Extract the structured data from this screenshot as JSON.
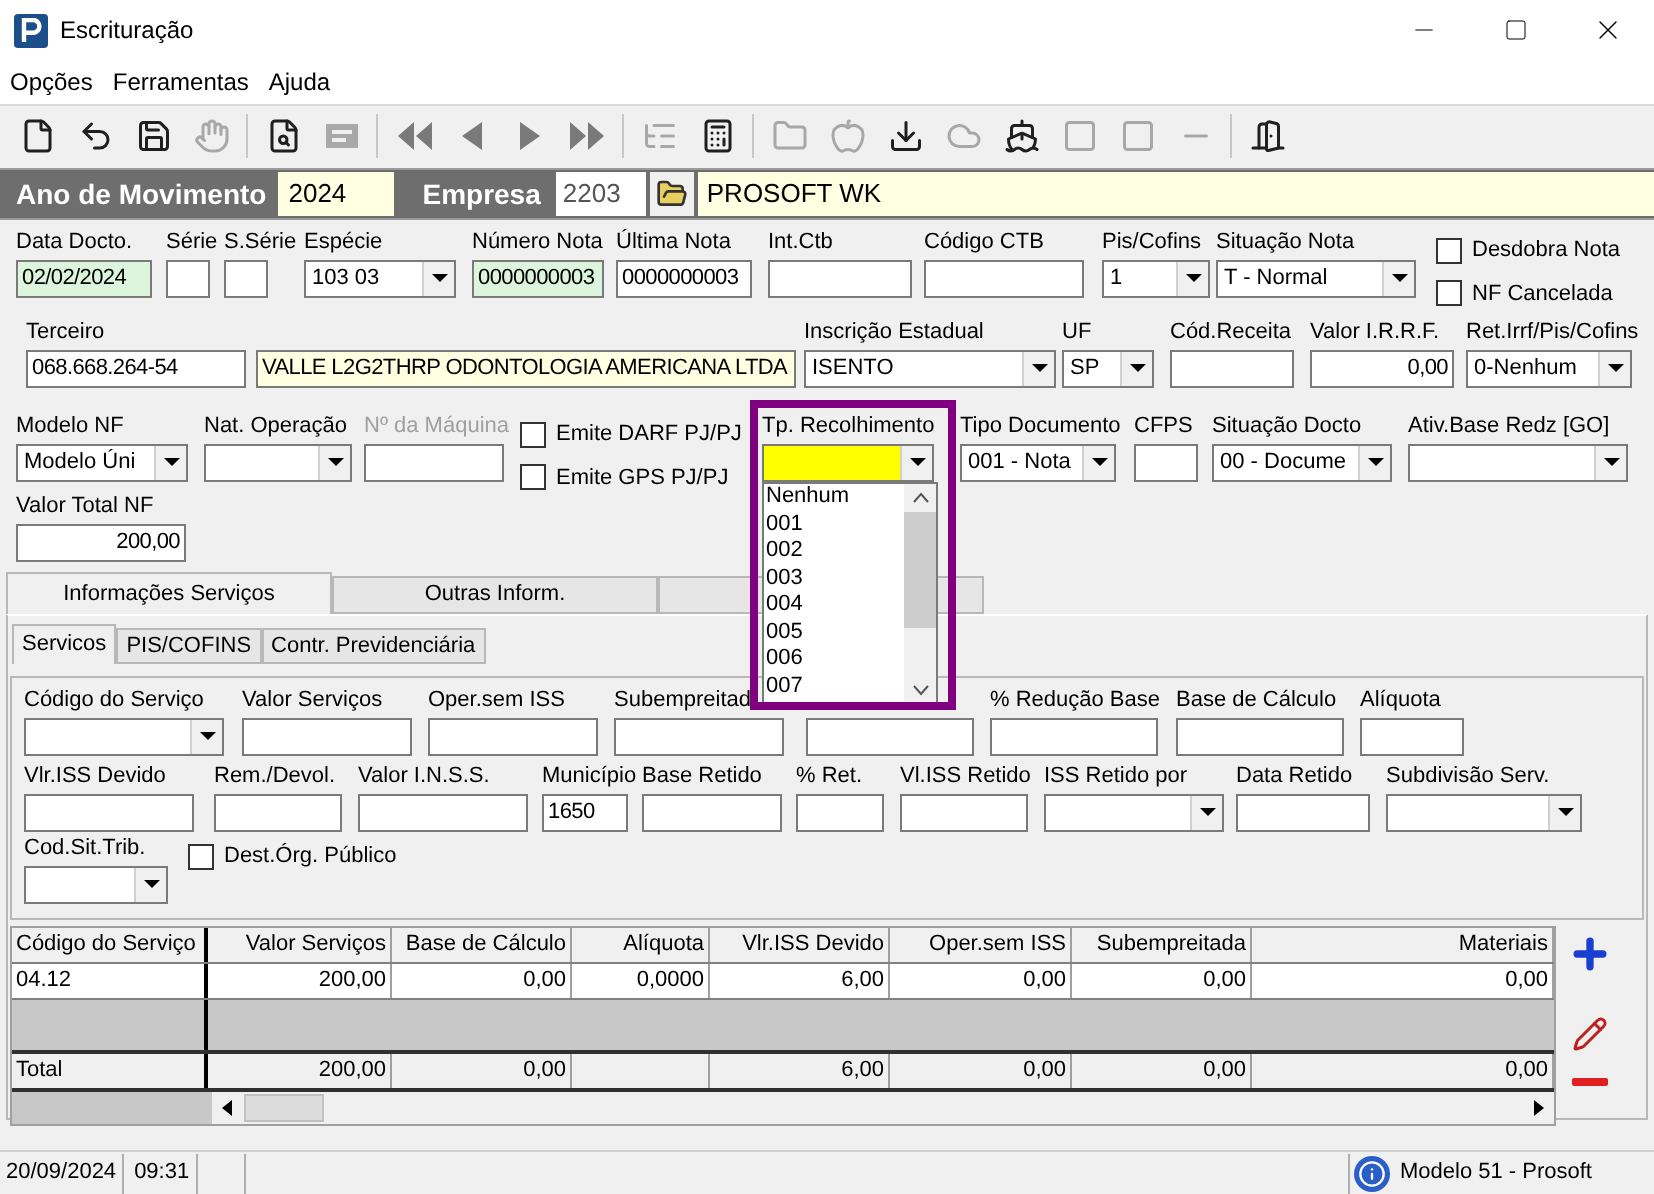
{
  "window": {
    "title": "Escrituração"
  },
  "menu": [
    "Opções",
    "Ferramentas",
    "Ajuda"
  ],
  "toolbar": [
    {
      "disabled": false
    },
    {
      "disabled": false
    },
    {
      "disabled": false
    },
    {
      "disabled": true
    },
    {
      "disabled": false
    },
    {
      "disabled": true
    },
    {
      "disabled": false
    },
    {
      "disabled": false
    },
    {
      "disabled": false
    },
    {
      "disabled": false
    },
    {
      "disabled": true
    },
    {
      "disabled": false
    },
    {
      "disabled": true
    },
    {
      "disabled": true
    },
    {
      "disabled": false
    },
    {
      "disabled": true
    },
    {
      "disabled": false
    },
    {
      "disabled": true
    },
    {
      "disabled": true
    },
    {
      "disabled": true
    },
    {
      "disabled": false
    }
  ],
  "header": {
    "year_label": "Ano de Movimento",
    "year": "2024",
    "company_label": "Empresa",
    "company_code": "2203",
    "company_name": "PROSOFT WK"
  },
  "form_rows": [
    {
      "fields": [
        {
          "label": "Data Docto.",
          "kind": "text",
          "value": "02/02/2024",
          "color": "#dcf5dc"
        },
        {
          "label": "Série",
          "kind": "text"
        },
        {
          "label": "S.Série",
          "kind": "text"
        },
        {
          "label": "Espécie",
          "kind": "combo",
          "value": "103 03"
        },
        {
          "label": "Número Nota",
          "kind": "text",
          "value": "0000000003",
          "color": "#dcf5dc"
        },
        {
          "label": "Última Nota",
          "kind": "text",
          "value": "0000000003"
        },
        {
          "label": "Int.Ctb",
          "kind": "text"
        },
        {
          "label": "Código CTB",
          "kind": "text"
        },
        {
          "label": "Pis/Cofins",
          "kind": "combo",
          "value": "1"
        },
        {
          "label": "Situação Nota",
          "kind": "combo",
          "value": "T - Normal"
        },
        {
          "kind": "checks",
          "items": [
            {
              "label": "Desdobra Nota",
              "checked": false
            },
            {
              "label": "NF Cancelada",
              "checked": false
            }
          ]
        }
      ]
    },
    {
      "fields": [
        {
          "label": "Terceiro",
          "kind": "text",
          "value": "068.668.264-54"
        },
        {
          "kind": "text",
          "value": "VALLE L2G2THRP ODONTOLOGIA AMERICANA LTDA",
          "color": "#ffffe1"
        },
        {
          "label": "Inscrição Estadual",
          "kind": "combo",
          "value": "ISENTO"
        },
        {
          "label": "UF",
          "kind": "combo",
          "value": "SP"
        },
        {
          "label": "Cód.Receita",
          "kind": "text"
        },
        {
          "label": "Valor I.R.R.F.",
          "kind": "number",
          "value": "0,00"
        },
        {
          "label": "Ret.Irrf/Pis/Cofins",
          "kind": "combo",
          "value": "0-Nenhum"
        }
      ]
    },
    {
      "fields": [
        {
          "label": "Modelo NF",
          "kind": "combo",
          "value": "Modelo Úni"
        },
        {
          "label": "Nat. Operação",
          "kind": "combo"
        },
        {
          "label": "Nº da Máquina",
          "kind": "text",
          "disabled": true
        },
        {
          "kind": "checks",
          "items": [
            {
              "label": "Emite DARF PJ/PJ",
              "checked": false
            },
            {
              "label": "Emite GPS PJ/PJ",
              "checked": false
            }
          ]
        },
        {
          "label": "Tp. Recolhimento",
          "kind": "combo",
          "color": "#ffff00",
          "expanded": true,
          "highlighted": true,
          "options": [
            "Nenhum",
            "001",
            "002",
            "003",
            "004",
            "005",
            "006",
            "007"
          ]
        },
        {
          "label": "Tipo Documento",
          "kind": "combo",
          "value": "001 - Nota"
        },
        {
          "label": "CFPS",
          "kind": "text"
        },
        {
          "label": "Situação Docto",
          "kind": "combo",
          "value": "00 - Docume"
        },
        {
          "label": "Ativ.Base Redz [GO]",
          "kind": "combo"
        }
      ]
    },
    {
      "fields": [
        {
          "label": "Valor Total NF",
          "kind": "number",
          "value": "200,00"
        }
      ]
    }
  ],
  "tabs": [
    {
      "label": "Informações Serviços",
      "selected": true
    },
    {
      "label": "Outras Inform.",
      "selected": false
    },
    {
      "selected": false
    }
  ],
  "subtabs": [
    {
      "label": "Servicos",
      "selected": true
    },
    {
      "label": "PIS/COFINS",
      "selected": false
    },
    {
      "label": "Contr. Previdenciária",
      "selected": false
    }
  ],
  "service_rows": [
    {
      "fields": [
        {
          "label": "Código do Serviço",
          "kind": "combo"
        },
        {
          "label": "Valor Serviços",
          "kind": "text"
        },
        {
          "label": "Oper.sem ISS",
          "kind": "text"
        },
        {
          "label": "Subempreitad",
          "kind": "text"
        },
        {
          "kind": "text"
        },
        {
          "label": "% Redução Base",
          "kind": "text"
        },
        {
          "label": "Base de Cálculo",
          "kind": "text"
        },
        {
          "label": "Alíquota",
          "kind": "text"
        }
      ]
    },
    {
      "fields": [
        {
          "label": "Vlr.ISS Devido",
          "kind": "text"
        },
        {
          "label": "Rem./Devol.",
          "kind": "text"
        },
        {
          "label": "Valor I.N.S.S.",
          "kind": "text"
        },
        {
          "label": "Município",
          "kind": "text",
          "value": "1650"
        },
        {
          "label": "Base Retido",
          "kind": "text"
        },
        {
          "label": "% Ret.",
          "kind": "text"
        },
        {
          "label": "Vl.ISS Retido",
          "kind": "text"
        },
        {
          "label": "ISS Retido por",
          "kind": "combo"
        },
        {
          "label": "Data Retido",
          "kind": "text"
        },
        {
          "label": "Subdivisão Serv.",
          "kind": "combo"
        }
      ]
    },
    {
      "fields": [
        {
          "label": "Cod.Sit.Trib.",
          "kind": "combo"
        },
        {
          "kind": "checks",
          "items": [
            {
              "label": "Dest.Órg. Público",
              "checked": false
            }
          ]
        }
      ]
    }
  ],
  "grid": {
    "columns": [
      "Código do Serviço",
      "Valor Serviços",
      "Base de Cálculo",
      "Alíquota",
      "Vlr.ISS Devido",
      "Oper.sem ISS",
      "Subempreitada",
      "Materiais"
    ],
    "rows": [
      [
        "04.12",
        "200,00",
        "0,00",
        "0,0000",
        "6,00",
        "0,00",
        "0,00",
        "0,00"
      ]
    ],
    "total": [
      {
        "kind": "text",
        "text": "Total"
      },
      {
        "kind": "text",
        "text": "200,00"
      },
      {
        "kind": "text",
        "text": "0,00"
      },
      {
        "kind": "blank"
      },
      {
        "kind": "text",
        "text": "6,00"
      },
      {
        "kind": "text",
        "text": "0,00"
      },
      {
        "kind": "text",
        "text": "0,00"
      },
      {
        "kind": "text",
        "text": "0,00"
      }
    ]
  },
  "status_bar": {
    "date": "20/09/2024",
    "time": "09:31",
    "message": "Modelo 51 - Prosoft"
  }
}
